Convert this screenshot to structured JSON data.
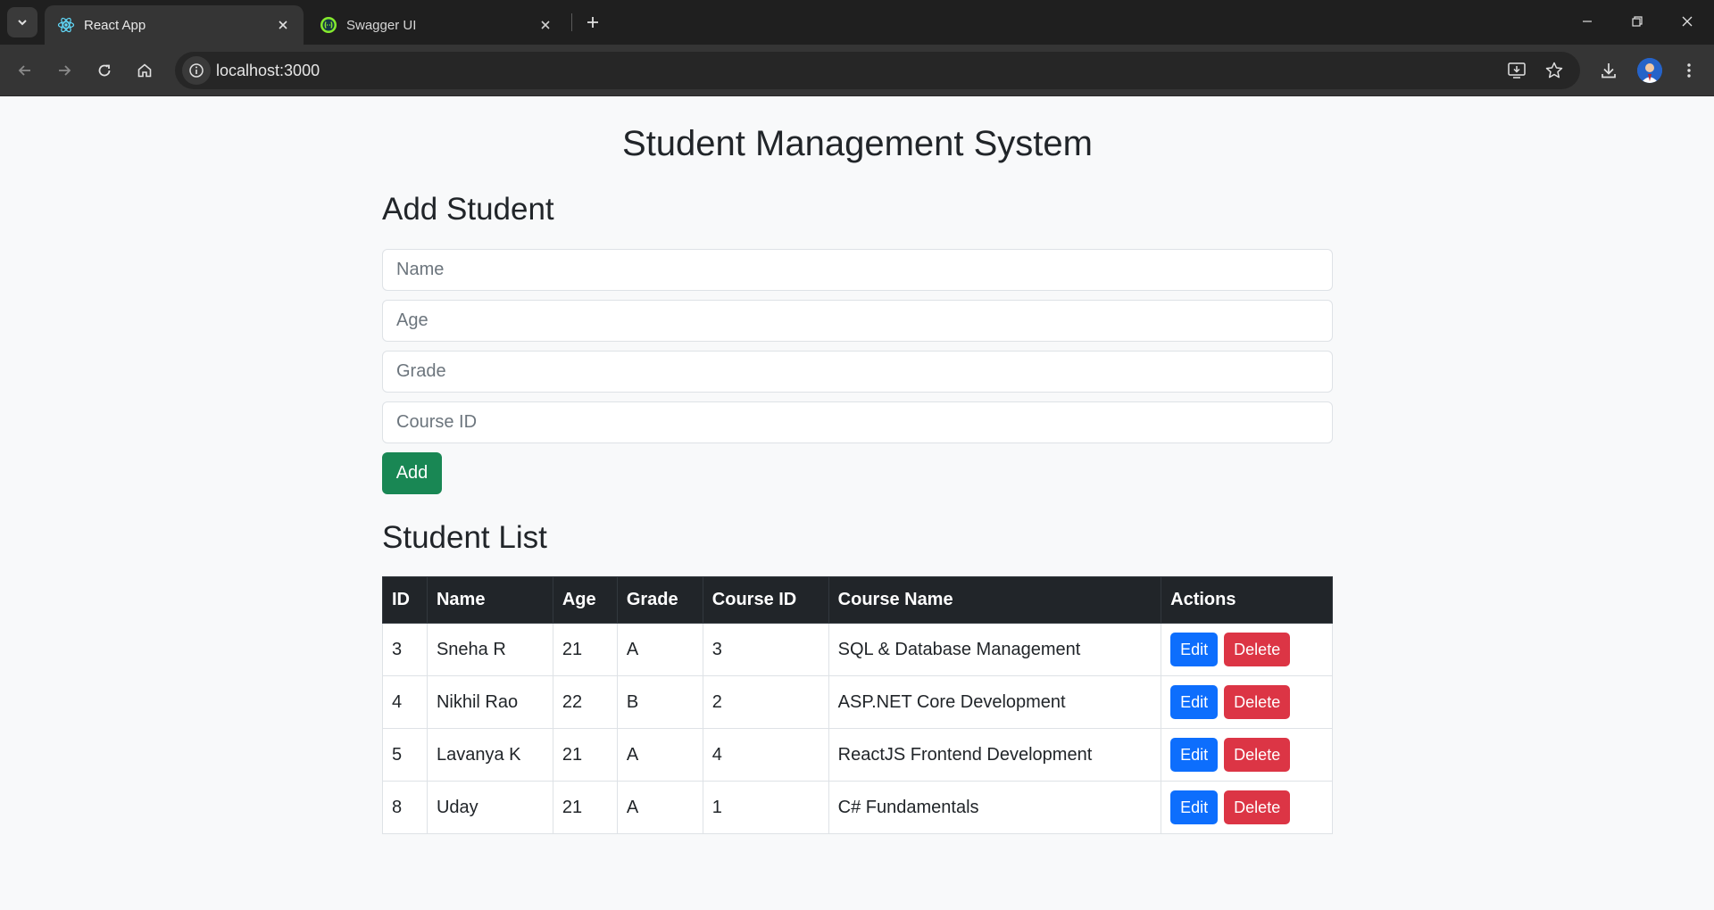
{
  "browser": {
    "tabs": [
      {
        "title": "React App",
        "icon": "react-icon",
        "active": true
      },
      {
        "title": "Swagger UI",
        "icon": "swagger-icon",
        "active": false
      }
    ],
    "url": "localhost:3000"
  },
  "page": {
    "title": "Student Management System",
    "add_section": {
      "heading": "Add Student",
      "fields": {
        "name_placeholder": "Name",
        "age_placeholder": "Age",
        "grade_placeholder": "Grade",
        "course_id_placeholder": "Course ID"
      },
      "add_label": "Add"
    },
    "list_section": {
      "heading": "Student List",
      "columns": [
        "ID",
        "Name",
        "Age",
        "Grade",
        "Course ID",
        "Course Name",
        "Actions"
      ],
      "rows": [
        {
          "id": "3",
          "name": "Sneha R",
          "age": "21",
          "grade": "A",
          "course_id": "3",
          "course_name": "SQL & Database Management"
        },
        {
          "id": "4",
          "name": "Nikhil Rao",
          "age": "22",
          "grade": "B",
          "course_id": "2",
          "course_name": "ASP.NET Core Development"
        },
        {
          "id": "5",
          "name": "Lavanya K",
          "age": "21",
          "grade": "A",
          "course_id": "4",
          "course_name": "ReactJS Frontend Development"
        },
        {
          "id": "8",
          "name": "Uday",
          "age": "21",
          "grade": "A",
          "course_id": "1",
          "course_name": "C# Fundamentals"
        }
      ],
      "edit_label": "Edit",
      "delete_label": "Delete"
    }
  },
  "colors": {
    "add_button": "#198754",
    "edit_button": "#0d6efd",
    "delete_button": "#dc3545",
    "table_header": "#212529"
  }
}
